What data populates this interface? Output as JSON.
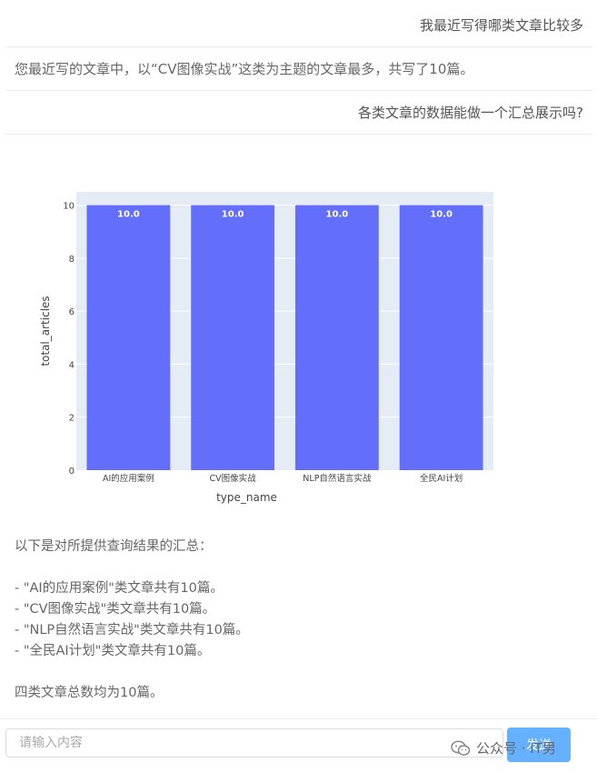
{
  "messages": [
    {
      "role": "user",
      "text": "我最近写得哪类文章比较多"
    },
    {
      "role": "bot",
      "text": "您最近写的文章中，以“CV图像实战”这类为主题的文章最多，共写了10篇。"
    },
    {
      "role": "user",
      "text": "各类文章的数据能做一个汇总展示吗?"
    }
  ],
  "chart_data": {
    "type": "bar",
    "categories": [
      "AI的应用案例",
      "CV图像实战",
      "NLP自然语言实战",
      "全民AI计划"
    ],
    "values": [
      10,
      10,
      10,
      10
    ],
    "data_labels": [
      "10.0",
      "10.0",
      "10.0",
      "10.0"
    ],
    "xlabel": "type_name",
    "ylabel": "total_articles",
    "ylim": [
      0,
      10.5
    ],
    "yticks": [
      0,
      2,
      4,
      6,
      8,
      10
    ],
    "grid": true,
    "bar_color": "#636efa",
    "plot_bg": "#e5ecf6"
  },
  "summary": {
    "intro": "以下是对所提供查询结果的汇总：",
    "items": [
      "- \"AI的应用案例\"类文章共有10篇。",
      "- \"CV图像实战\"类文章共有10篇。",
      "- \"NLP自然语言实战\"类文章共有10篇。",
      "- \"全民AI计划\"类文章共有10篇。"
    ],
    "conclusion": "四类文章总数均为10篇。"
  },
  "input": {
    "placeholder": "请输入内容",
    "send_label": "发送"
  },
  "watermark": {
    "text": "公众号 · IT男",
    "icon": "wechat-icon"
  },
  "colors": {
    "accent": "#66b1ff",
    "bar": "#636efa"
  }
}
